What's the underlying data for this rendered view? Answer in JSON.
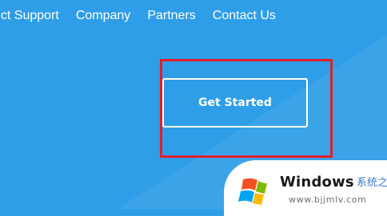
{
  "nav": {
    "items": [
      {
        "label": "uct Support"
      },
      {
        "label": "Company"
      },
      {
        "label": "Partners"
      },
      {
        "label": "Contact Us"
      }
    ]
  },
  "hero": {
    "cta_label": "Get Started"
  },
  "colors": {
    "background": "#2f9ee8",
    "highlight": "#e21f2a",
    "text": "#ffffff"
  },
  "watermark": {
    "title": "Windows",
    "cn_text": "系统之家",
    "url": "www.bjjmlv.com",
    "icon": "windows-logo-icon"
  }
}
